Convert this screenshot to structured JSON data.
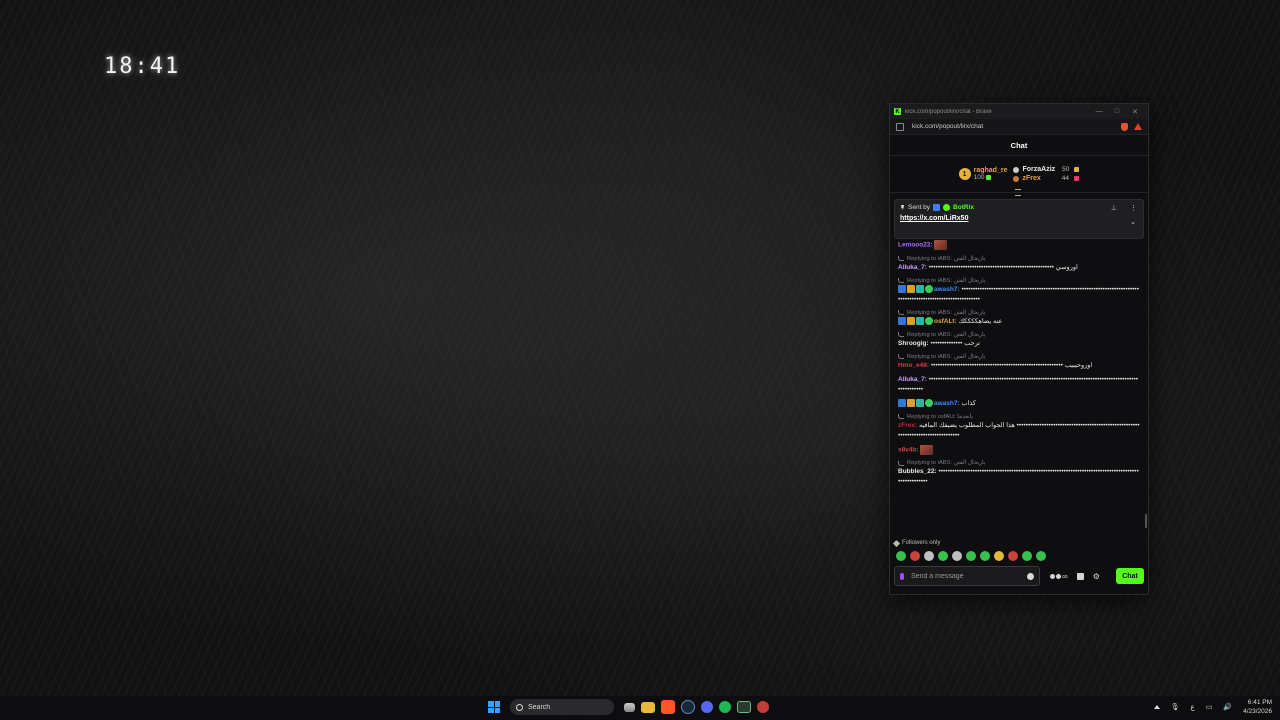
{
  "desktop": {
    "clock": "18:41"
  },
  "window": {
    "title": "kick.com/popout/lirx/chat - Brave",
    "url": "kick.com/popout/lirx/chat"
  },
  "chat": {
    "header": "Chat",
    "top_gifters": [
      {
        "rank_icon": "1",
        "name": "raghad_re",
        "count": "100"
      },
      {
        "name": "ForzaAziz",
        "count": "50"
      },
      {
        "name": "zFrex",
        "count": "44"
      }
    ],
    "pinned": {
      "sent_by_label": "Sent by",
      "sender": "BotRix",
      "link": "https://x.com/LiRx50"
    },
    "messages": [
      {
        "user": "Lemooo22:",
        "user_color": "#b06bff",
        "text": "",
        "emote": true
      },
      {
        "reply": "Replying to iABS: ياربحال الفتن",
        "user": "Alluka_7:",
        "user_color": "#c9a0ff",
        "text": "••••••••••••••••••••••••••••••••••••••••••••••••••••••• اوروسي"
      },
      {
        "reply": "Replying to iABS: ياربحال الفتن",
        "badges": true,
        "user": "awash7:",
        "user_color": "#3a8dff",
        "text": "••••••••••••••••••••••••••••••••••••••••••••••••••••••••••••••••••••••••••••••••••••••••••••••••••••••••••••••••••"
      },
      {
        "reply": "Replying to iABS: ياربحال الفتن",
        "badges": true,
        "user": "osfALt:",
        "user_color": "#e6a83a",
        "text": "عنه يضاهككككك"
      },
      {
        "reply": "Replying to iABS: ياربحال الفتن",
        "user": "Shroogig:",
        "user_color": "#e8e8e8",
        "text": "•••••••••••••• ترحب"
      },
      {
        "reply": "Replying to iABS: ياربحال الفتن",
        "user": "Hmo_e48:",
        "user_color": "#d83a4a",
        "text": "•••••••••••••••••••••••••••••••••••••••••••••••••••••••••• اوروحيبيب"
      },
      {
        "user": "Alluka_7:",
        "user_color": "#c9a0ff",
        "text": "•••••••••••••••••••••••••••••••••••••••••••••••••••••••••••••••••••••••••••••••••••••••••••••••••••••••"
      },
      {
        "badges": true,
        "user": "awash7:",
        "user_color": "#3a8dff",
        "text": "كذاب"
      },
      {
        "reply": "Replying to osfALt: يانعدما",
        "user": "zFrex:",
        "user_color": "#c0283a",
        "text": "هذا الجواب المطلوب يضيفك المافيه •••••••••••••••••••••••••••••••••••••••••••••••••••••••••••••••••••••••••••••••••"
      },
      {
        "user": "s8v4b:",
        "user_color": "#d83a4a",
        "text": "",
        "emote": true
      },
      {
        "reply": "Replying to iABS: ياربحال الفتن",
        "user": "Bubbles_22:",
        "user_color": "#e8e8e8",
        "text": "•••••••••••••••••••••••••••••••••••••••••••••••••••••••••••••••••••••••••••••••••••••••••••••••••••••"
      }
    ],
    "followers_only": "Followers only",
    "input_placeholder": "Send a message",
    "chat_button": "Chat"
  },
  "taskbar": {
    "search_placeholder": "Search",
    "time": "6:41 PM",
    "date": "4/23/2026"
  }
}
